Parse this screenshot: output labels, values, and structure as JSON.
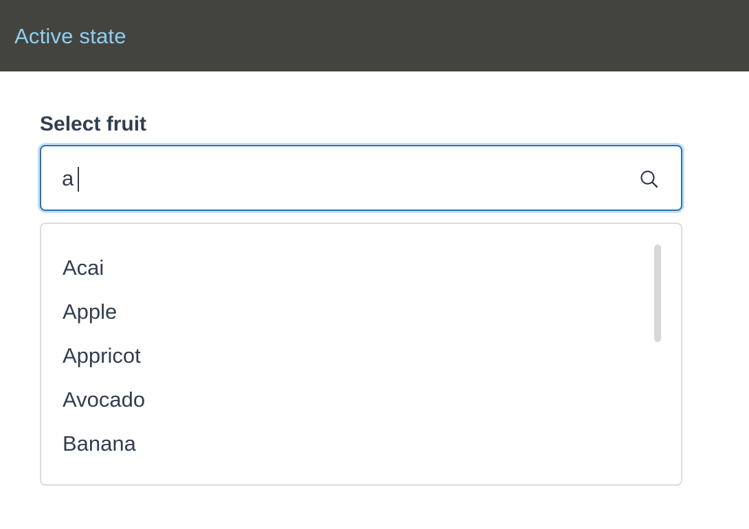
{
  "header": {
    "title": "Active state"
  },
  "field": {
    "label": "Select fruit",
    "value": "a",
    "icon": "search-icon"
  },
  "dropdown": {
    "options": [
      {
        "label": "Acai"
      },
      {
        "label": "Apple"
      },
      {
        "label": "Appricot"
      },
      {
        "label": "Avocado"
      },
      {
        "label": "Banana"
      }
    ]
  },
  "colors": {
    "header_bg": "#44443f",
    "header_text": "#8fcff2",
    "focus_border": "#2a6fb0",
    "text": "#323d4f"
  }
}
